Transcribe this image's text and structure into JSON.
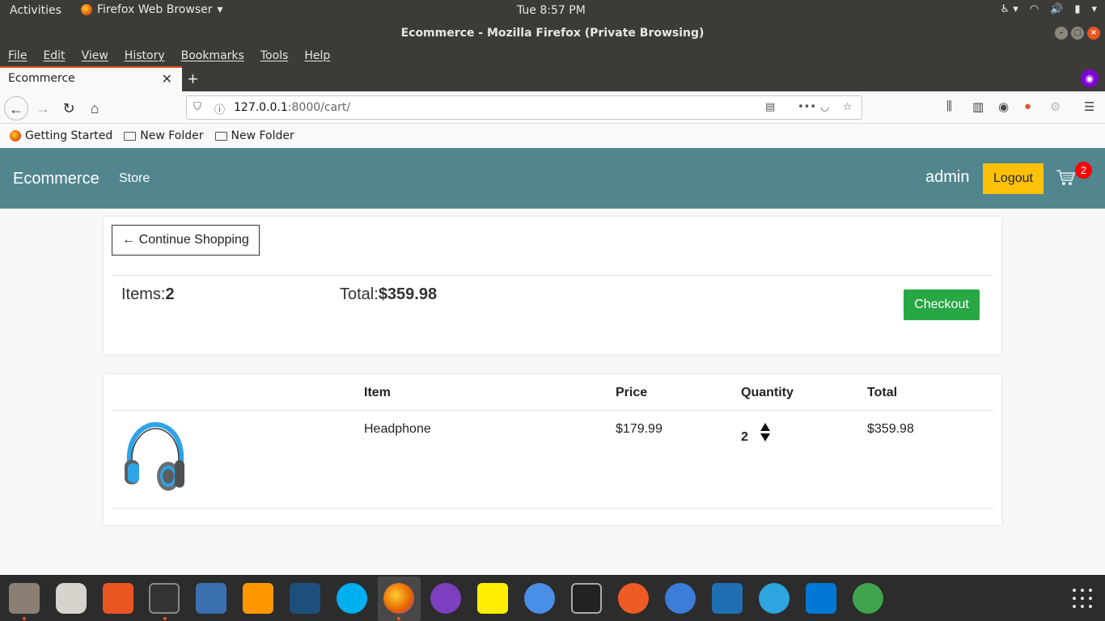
{
  "system": {
    "activities": "Activities",
    "app_name": "Firefox Web Browser",
    "clock": "Tue  8:57 PM"
  },
  "browser": {
    "window_title": "Ecommerce - Mozilla Firefox (Private Browsing)",
    "menu": [
      "File",
      "Edit",
      "View",
      "History",
      "Bookmarks",
      "Tools",
      "Help"
    ],
    "tab_title": "Ecommerce",
    "url_host": "127.0.0.1",
    "url_rest": ":8000/cart/",
    "bookmarks": [
      "Getting Started",
      "New Folder",
      "New Folder"
    ]
  },
  "site": {
    "brand": "Ecommerce",
    "store": "Store",
    "user": "admin",
    "logout": "Logout",
    "cart_count": "2"
  },
  "cart": {
    "continue_label": "← Continue Shopping",
    "items_label": "Items:",
    "items_value": "2",
    "total_label": "Total:",
    "total_value": "$359.98",
    "checkout_label": "Checkout",
    "columns": [
      "Item",
      "Price",
      "Quantity",
      "Total"
    ],
    "rows": [
      {
        "item": "Headphone",
        "price": "$179.99",
        "quantity": "2",
        "total": "$359.98"
      }
    ]
  },
  "colors": {
    "navbar": "#51868f",
    "logout": "#ffc107",
    "checkout": "#28a745",
    "badge": "#ff0000"
  }
}
